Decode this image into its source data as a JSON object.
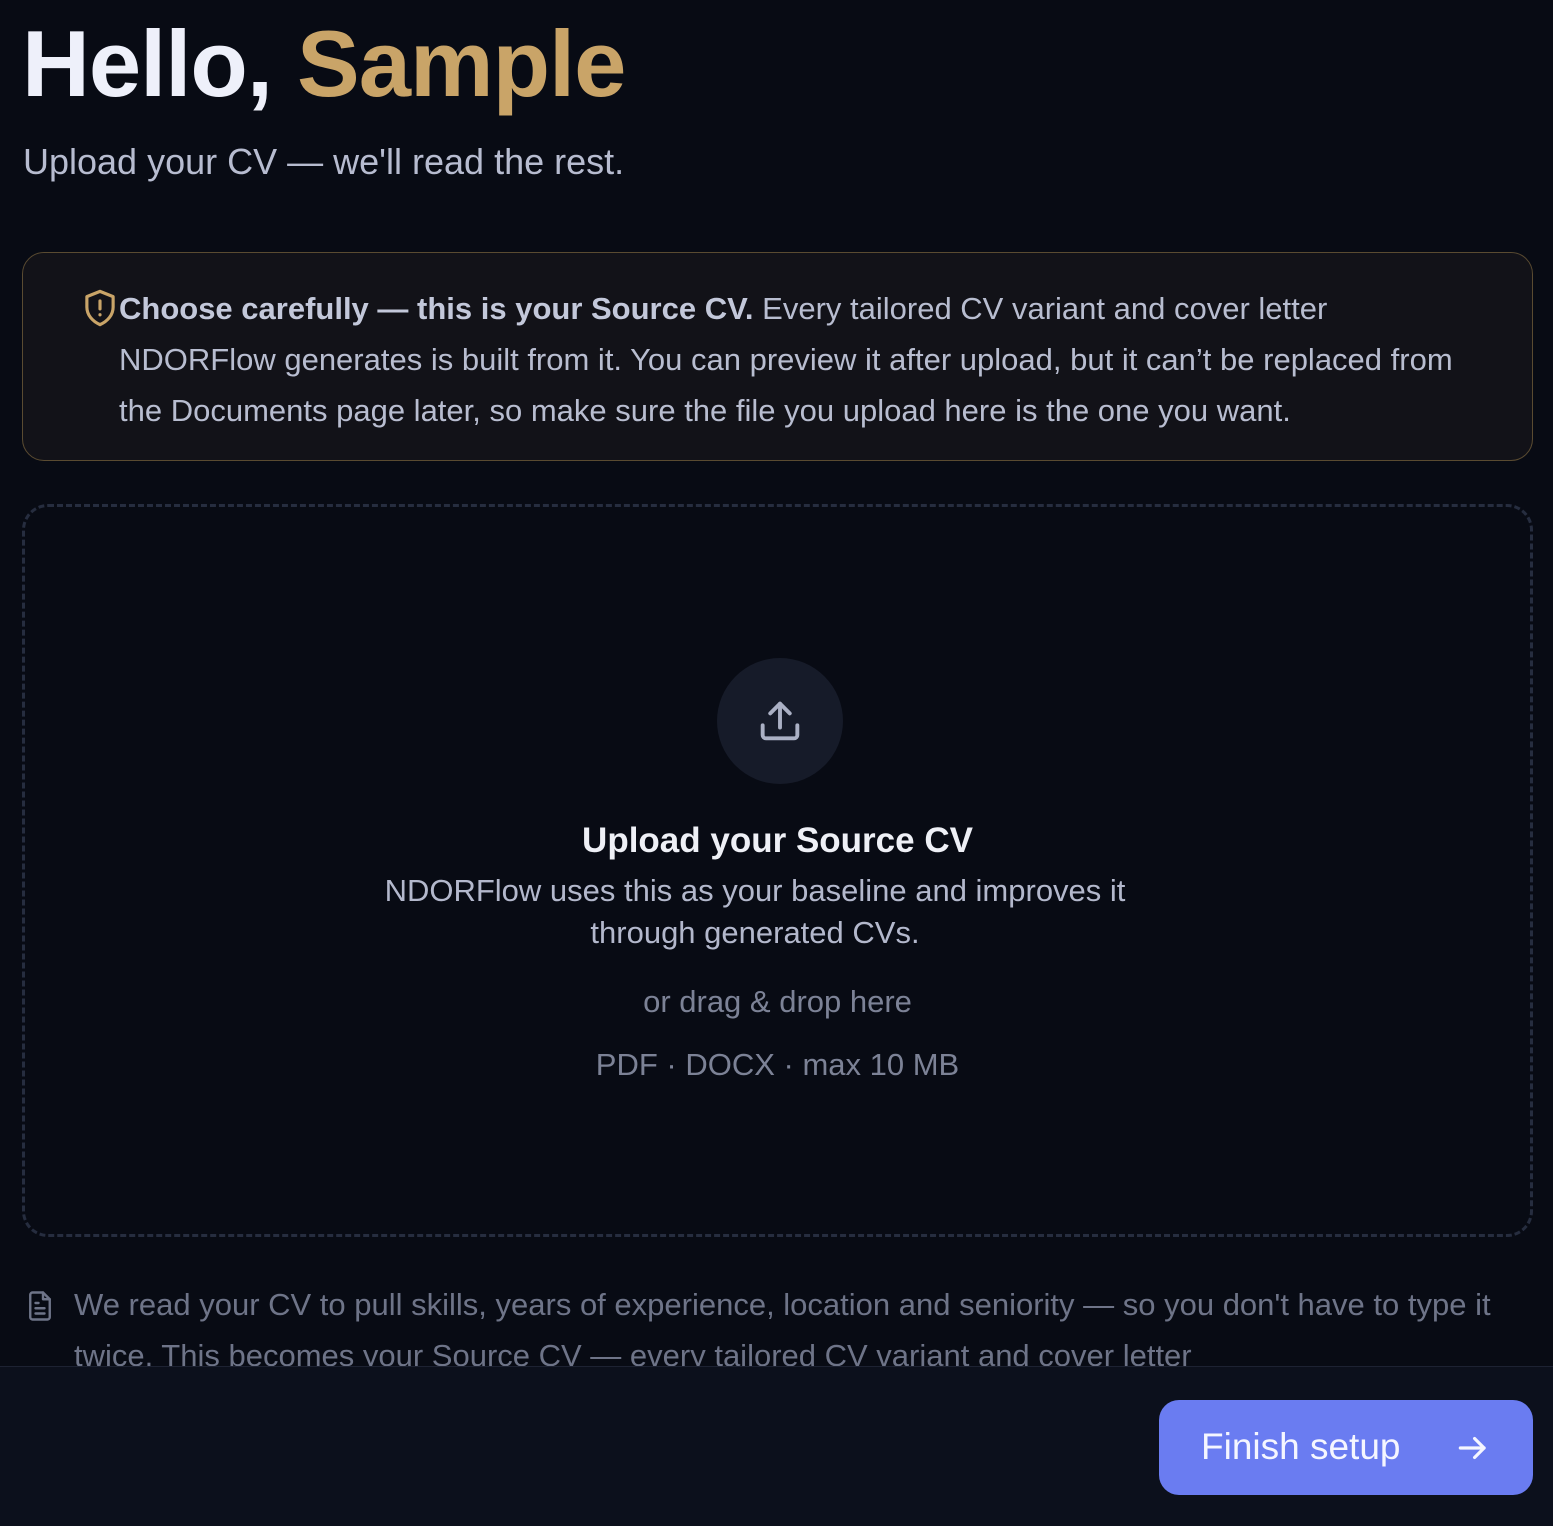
{
  "header": {
    "greeting_prefix": "Hello, ",
    "user_name": "Sample",
    "subtitle": "Upload your CV — we'll read the rest."
  },
  "warning": {
    "icon": "shield-alert-icon",
    "bold_text": "Choose carefully — this is your Source CV.",
    "body_text": " Every tailored CV variant and cover letter NDORFlow generates is built from it. You can preview it after upload, but it can’t be replaced from the Documents page later, so make sure the file you upload here is the one you want."
  },
  "dropzone": {
    "icon": "upload-icon",
    "title": "Upload your Source CV",
    "description": "NDORFlow uses this as your baseline and improves it through generated CVs.",
    "drag_hint": "or drag & drop here",
    "formats": "PDF · DOCX · max 10 MB"
  },
  "info_note": {
    "icon": "document-icon",
    "text": "We read your CV to pull skills, years of experience, location and seniority — so you don't have to type it twice. This becomes your Source CV — every tailored CV variant and cover letter"
  },
  "footer": {
    "finish_label": "Finish setup",
    "finish_icon": "arrow-right-icon"
  },
  "colors": {
    "background": "#080b14",
    "accent_gold": "#c9a468",
    "primary_button": "#6a7cf1"
  }
}
